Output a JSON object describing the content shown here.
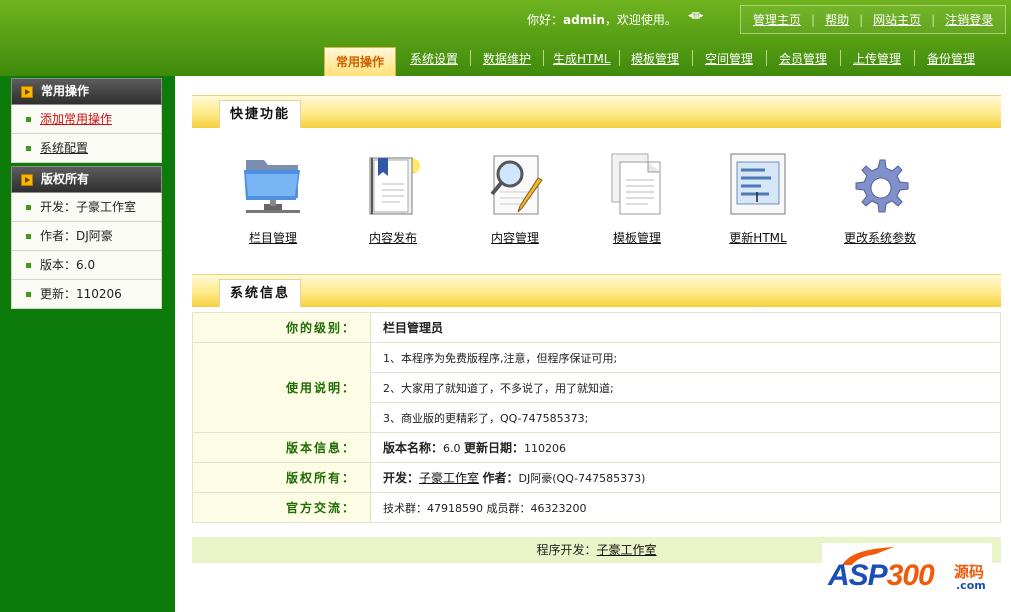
{
  "header": {
    "greeting_prefix": "你好：",
    "username": "admin",
    "greeting_suffix": "，欢迎使用。",
    "links": [
      "管理主页",
      "帮助",
      "网站主页",
      "注销登录"
    ]
  },
  "nav": {
    "active": "常用操作",
    "items": [
      "系统设置",
      "数据维护",
      "生成HTML",
      "模板管理",
      "空间管理",
      "会员管理",
      "上传管理",
      "备份管理"
    ]
  },
  "sidebar": {
    "sections": [
      {
        "title": "常用操作",
        "items": [
          "添加常用操作",
          "系统配置"
        ]
      },
      {
        "title": "版权所有",
        "items": [
          "开发：子豪工作室",
          "作者：DJ阿豪",
          "版本：6.0",
          "更新：110206"
        ]
      }
    ]
  },
  "quick": {
    "title": "快捷功能",
    "items": [
      {
        "label": "栏目管理",
        "icon": "folder-network-icon"
      },
      {
        "label": "内容发布",
        "icon": "book-publish-icon"
      },
      {
        "label": "内容管理",
        "icon": "document-search-icon"
      },
      {
        "label": "模板管理",
        "icon": "pages-icon"
      },
      {
        "label": "更新HTML",
        "icon": "html-document-icon"
      },
      {
        "label": "更改系统参数",
        "icon": "gear-icon"
      }
    ]
  },
  "sysinfo": {
    "title": "系统信息",
    "level_label": "你的级别：",
    "level_value": "栏目管理员",
    "usage_label": "使用说明：",
    "usage_lines": [
      "1、本程序为免费版程序,注意，但程序保证可用;",
      "2、大家用了就知道了，不多说了，用了就知道;",
      "3、商业版的更精彩了，QQ-747585373;"
    ],
    "version_label": "版本信息：",
    "version_name_label": "版本名称：",
    "version_name": "6.0",
    "update_date_label": "更新日期：",
    "update_date": "110206",
    "copyright_label": "版权所有：",
    "developer_label": "开发：",
    "developer": "子豪工作室",
    "author_label": "作者：",
    "author": "DJ阿豪(QQ-747585373)",
    "contact_label": "官方交流：",
    "contact": "技术群：47918590 成员群：46323200"
  },
  "footer": {
    "prefix": "程序开发：",
    "link": "子豪工作室"
  },
  "watermark": {
    "logo_a": "ASP",
    "logo_b": "300",
    "logo_cn": "源码",
    "logo_com": ".com"
  }
}
